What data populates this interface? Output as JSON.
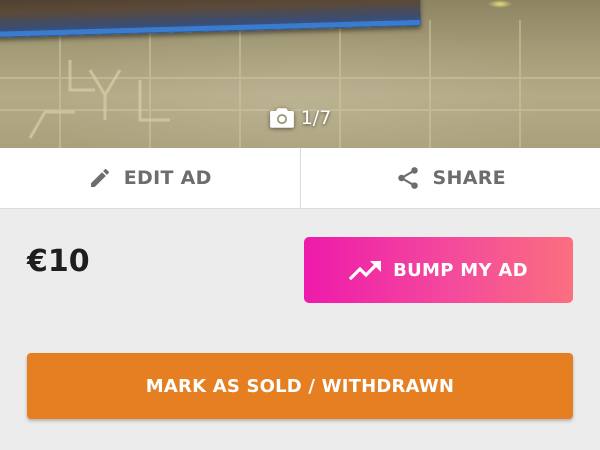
{
  "photo": {
    "counter": "1/7",
    "counter_icon": "camera-icon"
  },
  "actions": {
    "edit": {
      "label": "EDIT AD",
      "icon": "pencil-icon"
    },
    "share": {
      "label": "SHARE",
      "icon": "share-icon"
    }
  },
  "listing": {
    "price": "€10"
  },
  "bump": {
    "label": "BUMP MY AD",
    "icon": "trending-up-icon",
    "colors": [
      "#ee1aab",
      "#fb6f7f"
    ]
  },
  "mark_sold": {
    "label": "MARK AS SOLD / WITHDRAWN",
    "color": "#e67e22"
  }
}
